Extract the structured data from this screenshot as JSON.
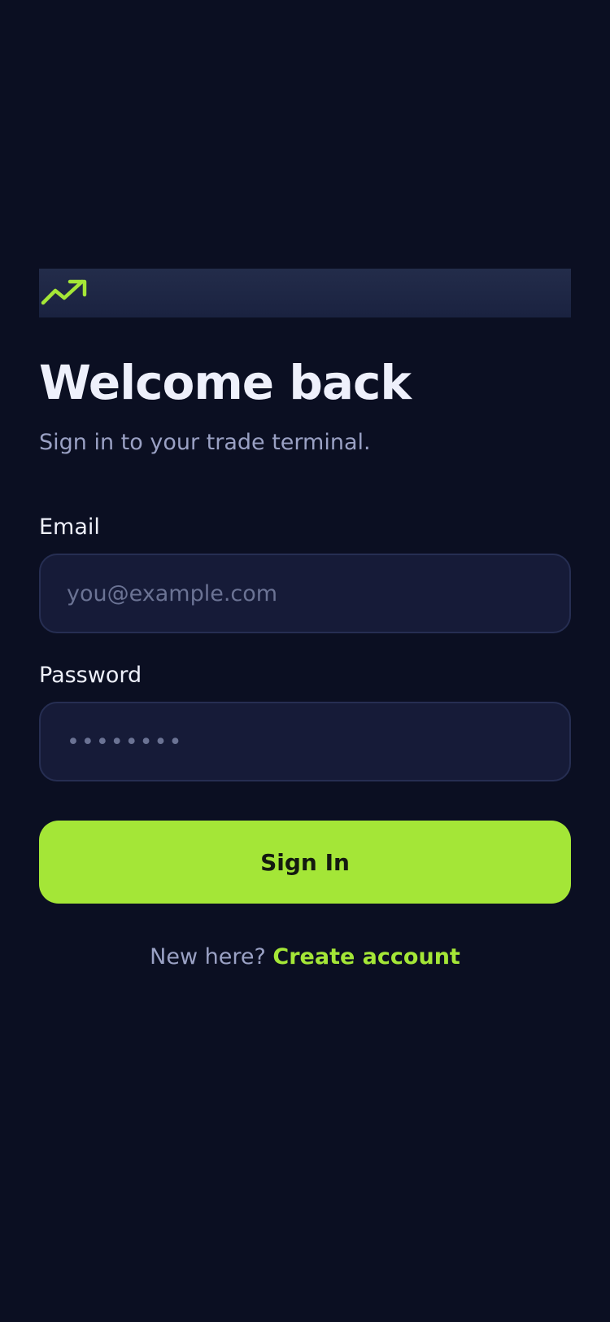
{
  "header": {
    "logo_icon": "trending-up-icon"
  },
  "title": "Welcome back",
  "subtitle": "Sign in to your trade terminal.",
  "form": {
    "email_label": "Email",
    "email_placeholder": "you@example.com",
    "email_value": "",
    "password_label": "Password",
    "password_placeholder": "••••••••",
    "password_value": "",
    "submit_label": "Sign In"
  },
  "footer": {
    "prompt": "New here?",
    "link_label": "Create account"
  },
  "colors": {
    "background": "#0b0f22",
    "accent": "#a4e637",
    "input_background": "#161b38",
    "text_primary": "#eef0fb",
    "text_muted": "#9aa1c4"
  }
}
